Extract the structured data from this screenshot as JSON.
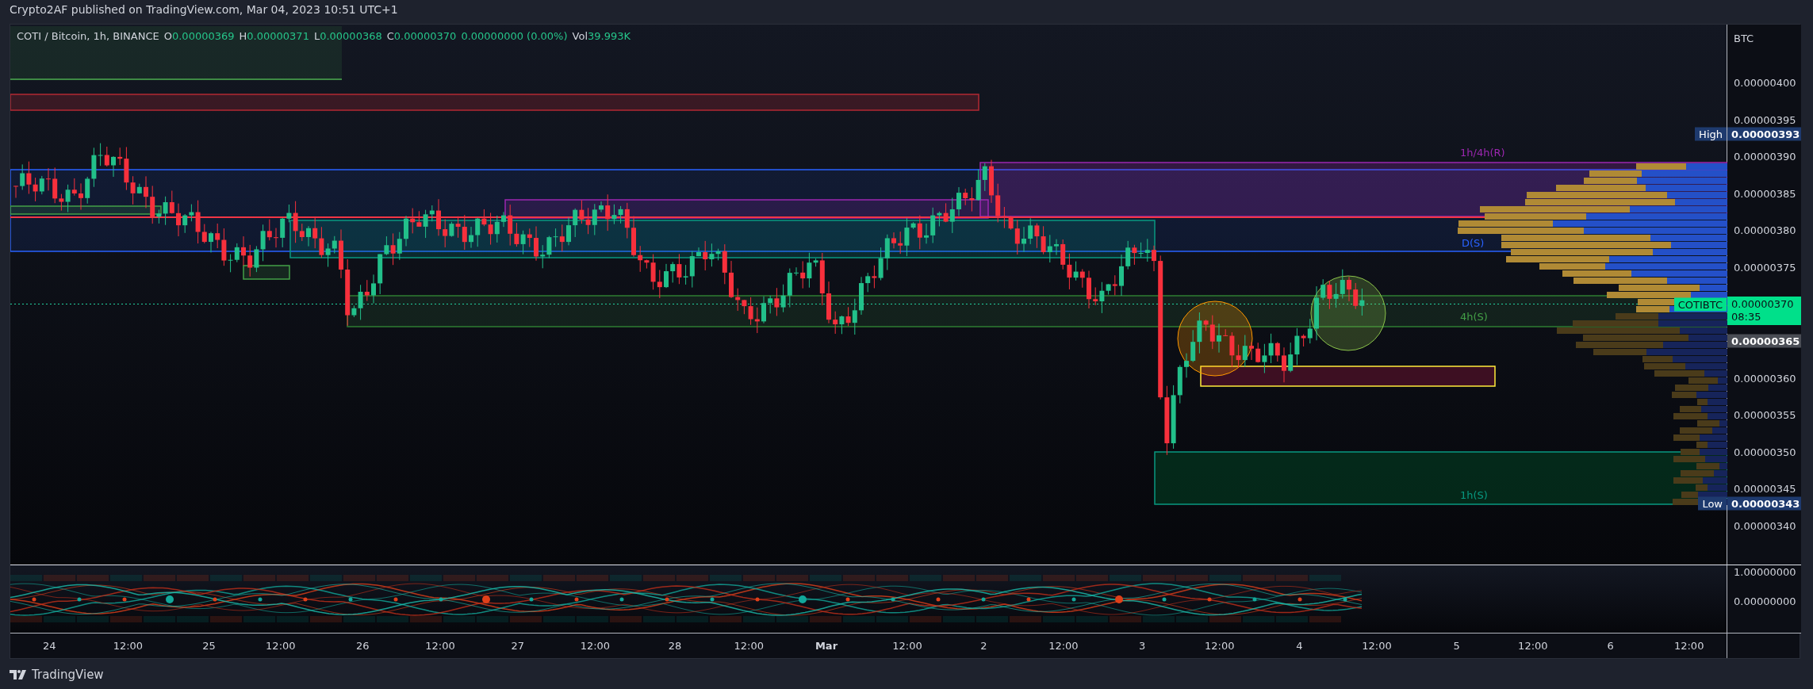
{
  "header": {
    "publisher_line": "Crypto2AF published on TradingView.com, Mar 04, 2023 10:51 UTC+1"
  },
  "legend": {
    "symbol": "COTI / Bitcoin, 1h, BINANCE",
    "ohlc": [
      {
        "label": "O",
        "value": "0.00000369"
      },
      {
        "label": "H",
        "value": "0.00000371"
      },
      {
        "label": "L",
        "value": "0.00000368"
      },
      {
        "label": "C",
        "value": "0.00000370"
      }
    ],
    "change": "0.00000000 (0.00%)",
    "volume_label": "Vol",
    "volume": "39.993K"
  },
  "zone_labels": [
    {
      "text": "1h/4h(R)",
      "color": "#9c27b0"
    },
    {
      "text": "D(S)",
      "color": "#2962ff"
    },
    {
      "text": "4h(S)",
      "color": "#43a047"
    },
    {
      "text": "1h(S)",
      "color": "#089981"
    }
  ],
  "price_axis": {
    "currency": "BTC",
    "ticks": [
      "0.00000400",
      "0.00000395",
      "0.00000390",
      "0.00000385",
      "0.00000380",
      "0.00000375",
      "0.00000360",
      "0.00000355",
      "0.00000350",
      "0.00000345",
      "0.00000340"
    ],
    "high": {
      "tag": "High",
      "value": "0.00000393"
    },
    "low": {
      "tag": "Low",
      "value": "0.00000343"
    },
    "last_price": {
      "symbol": "COTIBTC",
      "value": "0.00000370",
      "countdown": "08:35"
    },
    "marker": "0.00000365"
  },
  "indicator_axis": {
    "ticks": [
      "1.00000000",
      "0.00000000"
    ]
  },
  "time_axis": {
    "labels": [
      {
        "text": "24",
        "bold": false
      },
      {
        "text": "12:00",
        "bold": false
      },
      {
        "text": "25",
        "bold": false
      },
      {
        "text": "12:00",
        "bold": false
      },
      {
        "text": "26",
        "bold": false
      },
      {
        "text": "12:00",
        "bold": false
      },
      {
        "text": "27",
        "bold": false
      },
      {
        "text": "12:00",
        "bold": false
      },
      {
        "text": "28",
        "bold": false
      },
      {
        "text": "12:00",
        "bold": false
      },
      {
        "text": "Mar",
        "bold": true
      },
      {
        "text": "12:00",
        "bold": false
      },
      {
        "text": "2",
        "bold": false
      },
      {
        "text": "12:00",
        "bold": false
      },
      {
        "text": "3",
        "bold": false
      },
      {
        "text": "12:00",
        "bold": false
      },
      {
        "text": "4",
        "bold": false
      },
      {
        "text": "12:00",
        "bold": false
      },
      {
        "text": "5",
        "bold": false
      },
      {
        "text": "12:00",
        "bold": false
      },
      {
        "text": "6",
        "bold": false
      },
      {
        "text": "12:00",
        "bold": false
      }
    ]
  },
  "footer": {
    "brand": "TradingView"
  }
}
